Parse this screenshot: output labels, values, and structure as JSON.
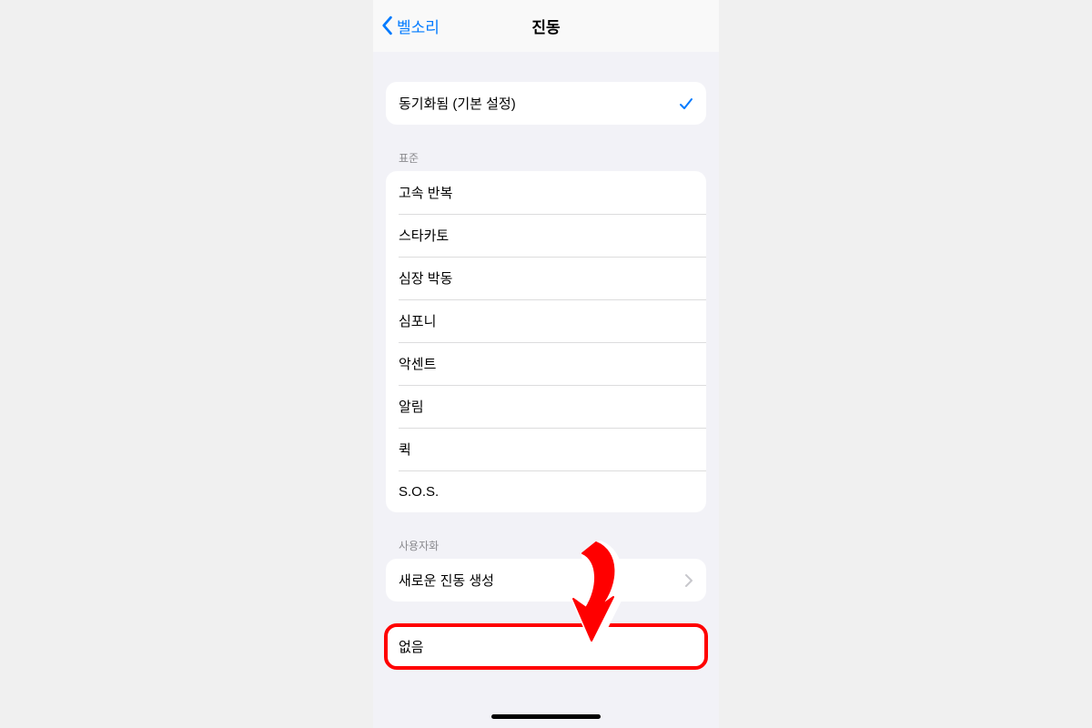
{
  "nav": {
    "back_label": "벨소리",
    "title": "진동"
  },
  "synced": {
    "label": "동기화됨 (기본 설정)",
    "selected": true
  },
  "standard": {
    "header": "표준",
    "items": [
      "고속 반복",
      "스타카토",
      "심장 박동",
      "심포니",
      "악센트",
      "알림",
      "퀵",
      "S.O.S."
    ]
  },
  "custom": {
    "header": "사용자화",
    "create_label": "새로운 진동 생성"
  },
  "none": {
    "label": "없음"
  },
  "colors": {
    "accent": "#007aff",
    "highlight": "#ff0000"
  }
}
